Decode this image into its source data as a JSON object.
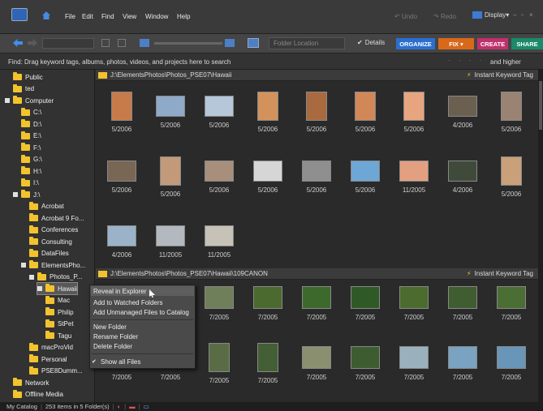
{
  "menu": {
    "items": [
      "File",
      "Edit",
      "Find",
      "View",
      "Window",
      "Help"
    ],
    "undo": "Undo",
    "redo": "Redo",
    "display": "Display"
  },
  "toolbar": {
    "location_placeholder": "Folder Location",
    "details": "Details",
    "organize": "ORGANIZE",
    "fix": "FIX",
    "create": "CREATE",
    "share": "SHARE"
  },
  "findbar": {
    "text": "Find: Drag keyword tags, albums, photos, videos, and projects here to search",
    "rating": "and higher"
  },
  "tree": [
    {
      "label": "Public",
      "indent": 1,
      "folder": true
    },
    {
      "label": "ted",
      "indent": 1,
      "folder": true
    },
    {
      "label": "Computer",
      "indent": 0,
      "folder": true,
      "expander": true
    },
    {
      "label": "C:\\",
      "indent": 2,
      "folder": true
    },
    {
      "label": "D:\\",
      "indent": 2,
      "folder": true
    },
    {
      "label": "E:\\",
      "indent": 2,
      "folder": true
    },
    {
      "label": "F:\\",
      "indent": 2,
      "folder": true
    },
    {
      "label": "G:\\",
      "indent": 2,
      "folder": true
    },
    {
      "label": "H:\\",
      "indent": 2,
      "folder": true
    },
    {
      "label": "I:\\",
      "indent": 2,
      "folder": true
    },
    {
      "label": "J:\\",
      "indent": 1,
      "folder": true,
      "expander": true
    },
    {
      "label": "Acrobat",
      "indent": 3,
      "folder": true
    },
    {
      "label": "Acrobat 9 Fo...",
      "indent": 3,
      "folder": true
    },
    {
      "label": "Conferences",
      "indent": 3,
      "folder": true
    },
    {
      "label": "Consulting",
      "indent": 3,
      "folder": true
    },
    {
      "label": "DataFiles",
      "indent": 3,
      "folder": true
    },
    {
      "label": "ElementsPho...",
      "indent": 2,
      "folder": true,
      "expander": true
    },
    {
      "label": "Photos_P...",
      "indent": 3,
      "folder": true,
      "expander": true
    },
    {
      "label": "Hawaii",
      "indent": 4,
      "folder": true,
      "expander": true,
      "selected": true
    },
    {
      "label": "Mac",
      "indent": 5,
      "folder": true
    },
    {
      "label": "Philip",
      "indent": 5,
      "folder": true
    },
    {
      "label": "StPet",
      "indent": 5,
      "folder": true
    },
    {
      "label": "Tagu",
      "indent": 5,
      "folder": true
    },
    {
      "label": "macProVid",
      "indent": 3,
      "folder": true
    },
    {
      "label": "Personal",
      "indent": 3,
      "folder": true
    },
    {
      "label": "PSE8Dumm...",
      "indent": 3,
      "folder": true
    },
    {
      "label": "Network",
      "indent": 1,
      "folder": true
    },
    {
      "label": "Offline Media",
      "indent": 1,
      "folder": true
    }
  ],
  "section1": {
    "path": "J:\\ElementsPhotos\\Photos_PSE07\\Hawaii",
    "keyword": "Instant Keyword Tag"
  },
  "section2": {
    "path": "J:\\ElementsPhotos\\Photos_PSE07\\Hawaii\\109CANON",
    "keyword": "Instant Keyword Tag"
  },
  "grid1_dates": [
    "5/2006",
    "5/2006",
    "5/2006",
    "5/2006",
    "5/2006",
    "5/2006",
    "5/2006",
    "4/2006",
    "5/2006",
    "5/2006",
    "5/2006",
    "5/2006",
    "5/2006",
    "5/2006",
    "5/2006",
    "11/2005",
    "4/2006",
    "5/2006",
    "4/2006",
    "11/2005",
    "11/2005"
  ],
  "grid2_dates": [
    "7/2005",
    "7/2005",
    "7/2005",
    "7/2005",
    "7/2005",
    "7/2005",
    "7/2005",
    "7/2005",
    "7/2005",
    "7/2005",
    "7/2005",
    "7/2005",
    "7/2005",
    "7/2005",
    "7/2005",
    "7/2005",
    "7/2005",
    "7/2005"
  ],
  "context_menu": {
    "reveal": "Reveal in Explorer",
    "add_watched": "Add to Watched Folders",
    "add_unmanaged": "Add Unmanaged Files to Catalog",
    "new_folder": "New Folder",
    "rename_folder": "Rename Folder",
    "delete_folder": "Delete Folder",
    "show_all": "Show all Files",
    "check": "✔"
  },
  "status": {
    "catalog": "My Catalog",
    "count": "253 items in 5 Folder(s)"
  },
  "colors": {
    "organize": "#2a6fd0",
    "fix": "#d9691a",
    "create": "#c0306c",
    "share": "#1a8a6a",
    "folder": "#f3c32e"
  }
}
